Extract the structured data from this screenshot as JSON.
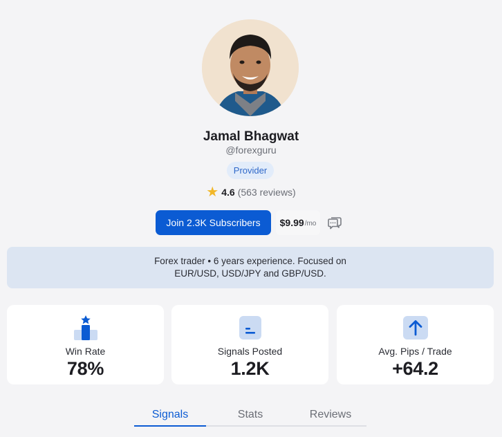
{
  "profile": {
    "name": "Jamal Bhagwat",
    "handle": "@forexguru",
    "badge": "Provider",
    "rating": "4.6",
    "reviews": "(563 reviews)"
  },
  "actions": {
    "join_label": "Join 2.3K Subscribers",
    "price": "$9.99",
    "price_period": "/mo"
  },
  "bio": {
    "line1": "Forex trader • 6 years experience. Focused on",
    "line2": "EUR/USD, USD/JPY and GBP/USD."
  },
  "stats": [
    {
      "label": "Win Rate",
      "value": "78%",
      "icon": "podium-star-icon"
    },
    {
      "label": "Signals Posted",
      "value": "1.2K",
      "icon": "signals-icon"
    },
    {
      "label": "Avg. Pips / Trade",
      "value": "+64.2",
      "icon": "arrow-up-icon"
    }
  ],
  "tabs": [
    {
      "label": "Signals",
      "active": true
    },
    {
      "label": "Stats",
      "active": false
    },
    {
      "label": "Reviews",
      "active": false
    }
  ],
  "colors": {
    "accent": "#0b5bd3",
    "background": "#f4f4f6",
    "bio_background": "#dce5f2",
    "badge_background": "#e2ecfa",
    "star": "#f2b729"
  }
}
